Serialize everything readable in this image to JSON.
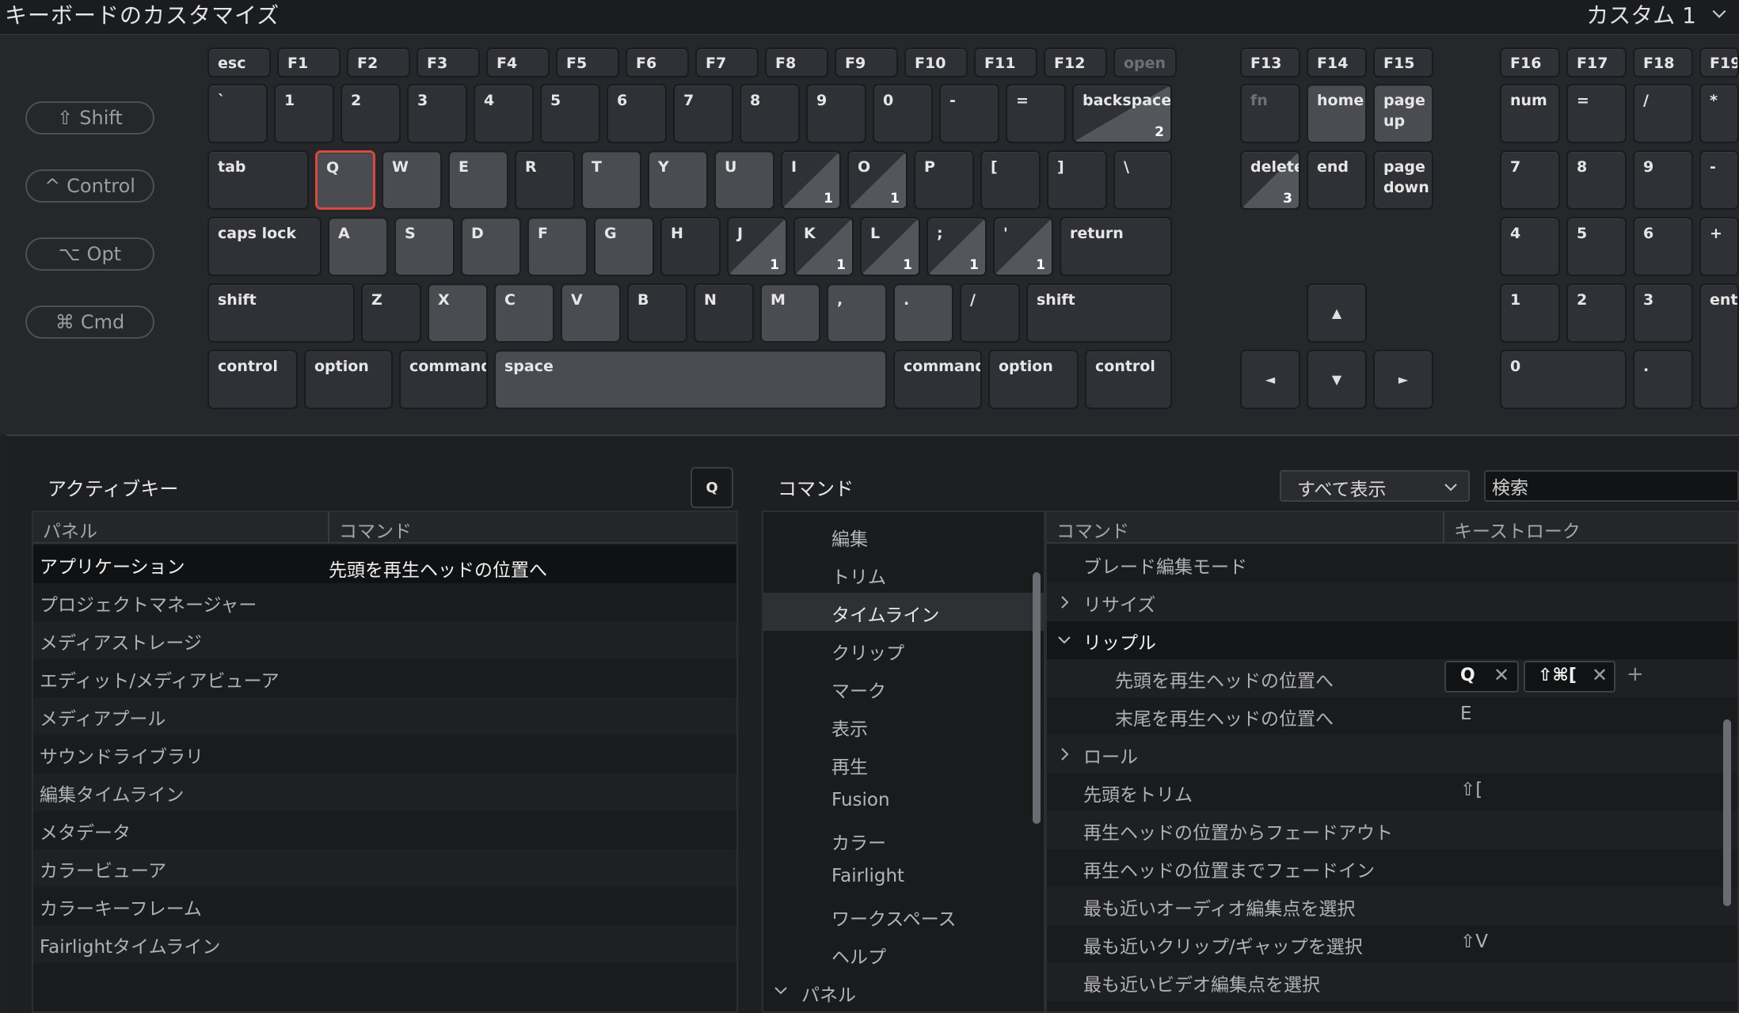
{
  "window": {
    "title": "キーボードのカスタマイズ",
    "preset": "カスタム 1"
  },
  "modifiers": [
    {
      "name": "shift",
      "glyph": "⇧",
      "label": "Shift"
    },
    {
      "name": "control",
      "glyph": "^",
      "label": "Control"
    },
    {
      "name": "opt",
      "glyph": "⌥",
      "label": "Opt"
    },
    {
      "name": "cmd",
      "glyph": "⌘",
      "label": "Cmd"
    }
  ],
  "keys": {
    "frow": [
      "esc",
      "F1",
      "F2",
      "F3",
      "F4",
      "F5",
      "F6",
      "F7",
      "F8",
      "F9",
      "F10",
      "F11",
      "F12",
      "open"
    ],
    "frow_right": [
      "F13",
      "F14",
      "F15"
    ],
    "frow_num": [
      "F16",
      "F17",
      "F18",
      "F19"
    ],
    "row1": [
      "`",
      "1",
      "2",
      "3",
      "4",
      "5",
      "6",
      "7",
      "8",
      "9",
      "0",
      "-",
      "=",
      "backspace"
    ],
    "row2": [
      "tab",
      "Q",
      "W",
      "E",
      "R",
      "T",
      "Y",
      "U",
      "I",
      "O",
      "P",
      "[",
      "]",
      "\\"
    ],
    "row3": [
      "caps lock",
      "A",
      "S",
      "D",
      "F",
      "G",
      "H",
      "J",
      "K",
      "L",
      ";",
      "'",
      "return"
    ],
    "row4": [
      "shift",
      "Z",
      "X",
      "C",
      "V",
      "B",
      "N",
      "M",
      ",",
      ".",
      "/",
      "shift"
    ],
    "row5": [
      "control",
      "option",
      "command",
      "space",
      "command",
      "option",
      "control"
    ],
    "nav1": [
      "fn",
      "home",
      "page\nup"
    ],
    "nav2": [
      "delete",
      "end",
      "page\ndown"
    ],
    "arrows": {
      "up": "▲",
      "left": "◄",
      "down": "▼",
      "right": "►"
    },
    "num1": [
      "num",
      "=",
      "/",
      "*"
    ],
    "num2": [
      "7",
      "8",
      "9",
      "-"
    ],
    "num3": [
      "4",
      "5",
      "6",
      "+"
    ],
    "num4": [
      "1",
      "2",
      "3",
      "ente"
    ],
    "num5": [
      "0",
      "."
    ],
    "counts": {
      "backspace": "2",
      "I": "1",
      "O": "1",
      "J": "1",
      "K": "1",
      "L": "1",
      "semicolon": "1",
      "quote": "1",
      "delete": "3"
    }
  },
  "active_keys": {
    "title": "アクティブキー",
    "selected_key": "Q",
    "columns": [
      "パネル",
      "コマンド"
    ],
    "rows": [
      {
        "panel": "アプリケーション",
        "command": "先頭を再生ヘッドの位置へ"
      },
      {
        "panel": "プロジェクトマネージャー",
        "command": ""
      },
      {
        "panel": "メディアストレージ",
        "command": ""
      },
      {
        "panel": "エディット/メディアビューア",
        "command": ""
      },
      {
        "panel": "メディアプール",
        "command": ""
      },
      {
        "panel": "サウンドライブラリ",
        "command": ""
      },
      {
        "panel": "編集タイムライン",
        "command": ""
      },
      {
        "panel": "メタデータ",
        "command": ""
      },
      {
        "panel": "カラービューア",
        "command": ""
      },
      {
        "panel": "カラーキーフレーム",
        "command": ""
      },
      {
        "panel": "Fairlightタイムライン",
        "command": ""
      }
    ]
  },
  "commands": {
    "title": "コマンド",
    "filter": "すべて表示",
    "search_value": "検索",
    "nav": [
      "編集",
      "トリム",
      "タイムライン",
      "クリップ",
      "マーク",
      "表示",
      "再生",
      "Fusion",
      "カラー",
      "Fairlight",
      "ワークスペース",
      "ヘルプ"
    ],
    "nav_panel": "パネル",
    "columns": [
      "コマンド",
      "キーストローク"
    ],
    "rows": [
      {
        "label": "ブレード編集モード",
        "keys": ""
      },
      {
        "label": "リサイズ",
        "keys": ""
      },
      {
        "label": "リップル",
        "keys": ""
      },
      {
        "label": "先頭を再生ヘッドの位置へ",
        "keys": ""
      },
      {
        "label": "末尾を再生ヘッドの位置へ",
        "keys": "E"
      },
      {
        "label": "ロール",
        "keys": ""
      },
      {
        "label": "先頭をトリム",
        "keys": "⇧["
      },
      {
        "label": "再生ヘッドの位置からフェードアウト",
        "keys": ""
      },
      {
        "label": "再生ヘッドの位置までフェードイン",
        "keys": ""
      },
      {
        "label": "最も近いオーディオ編集点を選択",
        "keys": ""
      },
      {
        "label": "最も近いクリップ/ギャップを選択",
        "keys": "⇧V"
      },
      {
        "label": "最も近いビデオ編集点を選択",
        "keys": ""
      }
    ],
    "chips": {
      "first": "Q",
      "second": "⇧⌘[",
      "add": "+",
      "remove": "✕"
    }
  }
}
